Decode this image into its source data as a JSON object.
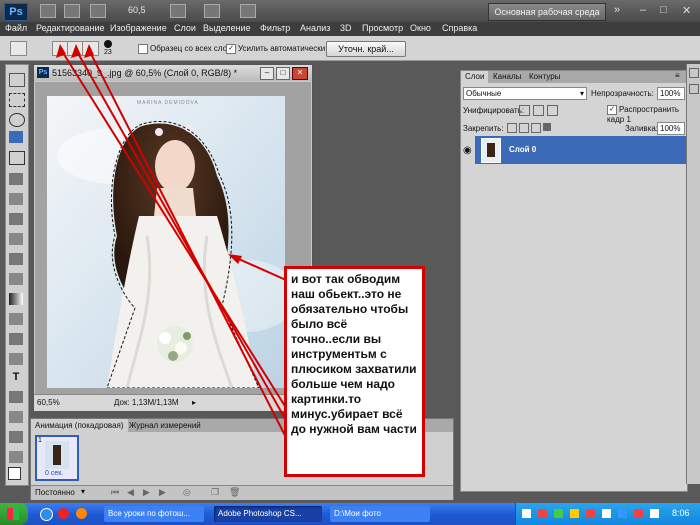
{
  "app": {
    "logo": "Ps",
    "zoom": "60,5",
    "workspace": "Основная рабочая среда"
  },
  "menu": [
    "Файл",
    "Редактирование",
    "Изображение",
    "Слои",
    "Выделение",
    "Фильтр",
    "Анализ",
    "3D",
    "Просмотр",
    "Окно",
    "Справка"
  ],
  "options": {
    "brush_size": "23",
    "sample_all_label": "Образец со всех слоев",
    "auto_enhance_label": "Усилить автоматически",
    "refine_edge_label": "Уточн. край..."
  },
  "document": {
    "title": "51563340_9_.jpg @ 60,5% (Слой 0, RGB/8) *",
    "zoom_readout": "60,5%",
    "doc_size": "Док: 1,13M/1,13M",
    "watermark": "MARINA DEMIDOVA"
  },
  "layers_panel": {
    "tabs": [
      "Слои",
      "Каналы",
      "Контуры"
    ],
    "blend_mode": "Обычные",
    "opacity_label": "Непрозрачность:",
    "opacity_value": "100%",
    "unify_label": "Унифицировать:",
    "propagate_label": "Распространить кадр 1",
    "lock_label": "Закрепить:",
    "fill_label": "Заливка:",
    "fill_value": "100%",
    "layer_name": "Слой 0"
  },
  "animation_panel": {
    "tabs": [
      "Анимация (покадровая)",
      "Журнал измерений"
    ],
    "frame_number": "1",
    "frame_delay": "0 сек.",
    "loop_mode": "Постоянно"
  },
  "annotation": "и вот так обводим наш обьект..это не обязательно чтобы было всё точно..если вы инструментьм с плюсиком захватили больше чем надо картинки.то минус.убирает всё до нужной вам части",
  "taskbar": {
    "tasks": [
      "Все уроки по фотош...",
      "Adobe Photoshop CS...",
      "D:\\Мои фото"
    ],
    "clock": "8:06"
  },
  "colors": {
    "annotation_red": "#d40000",
    "layer_selected": "#3a6ab8",
    "taskbar_blue": "#1f5bd6"
  }
}
